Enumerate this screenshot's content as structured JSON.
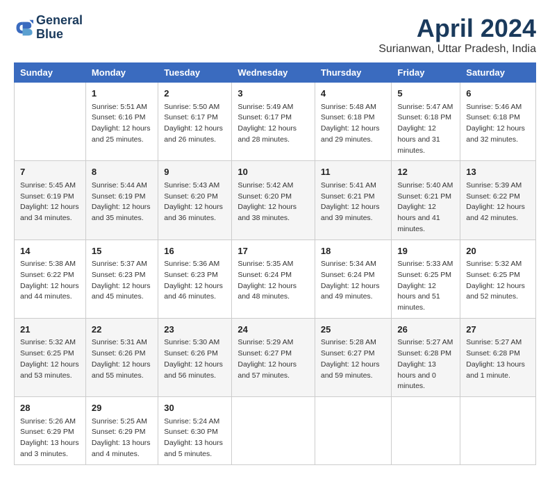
{
  "header": {
    "logo_line1": "General",
    "logo_line2": "Blue",
    "title": "April 2024",
    "subtitle": "Surianwan, Uttar Pradesh, India"
  },
  "days_of_week": [
    "Sunday",
    "Monday",
    "Tuesday",
    "Wednesday",
    "Thursday",
    "Friday",
    "Saturday"
  ],
  "weeks": [
    [
      {
        "day": "",
        "sunrise": "",
        "sunset": "",
        "daylight": ""
      },
      {
        "day": "1",
        "sunrise": "Sunrise: 5:51 AM",
        "sunset": "Sunset: 6:16 PM",
        "daylight": "Daylight: 12 hours and 25 minutes."
      },
      {
        "day": "2",
        "sunrise": "Sunrise: 5:50 AM",
        "sunset": "Sunset: 6:17 PM",
        "daylight": "Daylight: 12 hours and 26 minutes."
      },
      {
        "day": "3",
        "sunrise": "Sunrise: 5:49 AM",
        "sunset": "Sunset: 6:17 PM",
        "daylight": "Daylight: 12 hours and 28 minutes."
      },
      {
        "day": "4",
        "sunrise": "Sunrise: 5:48 AM",
        "sunset": "Sunset: 6:18 PM",
        "daylight": "Daylight: 12 hours and 29 minutes."
      },
      {
        "day": "5",
        "sunrise": "Sunrise: 5:47 AM",
        "sunset": "Sunset: 6:18 PM",
        "daylight": "Daylight: 12 hours and 31 minutes."
      },
      {
        "day": "6",
        "sunrise": "Sunrise: 5:46 AM",
        "sunset": "Sunset: 6:18 PM",
        "daylight": "Daylight: 12 hours and 32 minutes."
      }
    ],
    [
      {
        "day": "7",
        "sunrise": "Sunrise: 5:45 AM",
        "sunset": "Sunset: 6:19 PM",
        "daylight": "Daylight: 12 hours and 34 minutes."
      },
      {
        "day": "8",
        "sunrise": "Sunrise: 5:44 AM",
        "sunset": "Sunset: 6:19 PM",
        "daylight": "Daylight: 12 hours and 35 minutes."
      },
      {
        "day": "9",
        "sunrise": "Sunrise: 5:43 AM",
        "sunset": "Sunset: 6:20 PM",
        "daylight": "Daylight: 12 hours and 36 minutes."
      },
      {
        "day": "10",
        "sunrise": "Sunrise: 5:42 AM",
        "sunset": "Sunset: 6:20 PM",
        "daylight": "Daylight: 12 hours and 38 minutes."
      },
      {
        "day": "11",
        "sunrise": "Sunrise: 5:41 AM",
        "sunset": "Sunset: 6:21 PM",
        "daylight": "Daylight: 12 hours and 39 minutes."
      },
      {
        "day": "12",
        "sunrise": "Sunrise: 5:40 AM",
        "sunset": "Sunset: 6:21 PM",
        "daylight": "Daylight: 12 hours and 41 minutes."
      },
      {
        "day": "13",
        "sunrise": "Sunrise: 5:39 AM",
        "sunset": "Sunset: 6:22 PM",
        "daylight": "Daylight: 12 hours and 42 minutes."
      }
    ],
    [
      {
        "day": "14",
        "sunrise": "Sunrise: 5:38 AM",
        "sunset": "Sunset: 6:22 PM",
        "daylight": "Daylight: 12 hours and 44 minutes."
      },
      {
        "day": "15",
        "sunrise": "Sunrise: 5:37 AM",
        "sunset": "Sunset: 6:23 PM",
        "daylight": "Daylight: 12 hours and 45 minutes."
      },
      {
        "day": "16",
        "sunrise": "Sunrise: 5:36 AM",
        "sunset": "Sunset: 6:23 PM",
        "daylight": "Daylight: 12 hours and 46 minutes."
      },
      {
        "day": "17",
        "sunrise": "Sunrise: 5:35 AM",
        "sunset": "Sunset: 6:24 PM",
        "daylight": "Daylight: 12 hours and 48 minutes."
      },
      {
        "day": "18",
        "sunrise": "Sunrise: 5:34 AM",
        "sunset": "Sunset: 6:24 PM",
        "daylight": "Daylight: 12 hours and 49 minutes."
      },
      {
        "day": "19",
        "sunrise": "Sunrise: 5:33 AM",
        "sunset": "Sunset: 6:25 PM",
        "daylight": "Daylight: 12 hours and 51 minutes."
      },
      {
        "day": "20",
        "sunrise": "Sunrise: 5:32 AM",
        "sunset": "Sunset: 6:25 PM",
        "daylight": "Daylight: 12 hours and 52 minutes."
      }
    ],
    [
      {
        "day": "21",
        "sunrise": "Sunrise: 5:32 AM",
        "sunset": "Sunset: 6:25 PM",
        "daylight": "Daylight: 12 hours and 53 minutes."
      },
      {
        "day": "22",
        "sunrise": "Sunrise: 5:31 AM",
        "sunset": "Sunset: 6:26 PM",
        "daylight": "Daylight: 12 hours and 55 minutes."
      },
      {
        "day": "23",
        "sunrise": "Sunrise: 5:30 AM",
        "sunset": "Sunset: 6:26 PM",
        "daylight": "Daylight: 12 hours and 56 minutes."
      },
      {
        "day": "24",
        "sunrise": "Sunrise: 5:29 AM",
        "sunset": "Sunset: 6:27 PM",
        "daylight": "Daylight: 12 hours and 57 minutes."
      },
      {
        "day": "25",
        "sunrise": "Sunrise: 5:28 AM",
        "sunset": "Sunset: 6:27 PM",
        "daylight": "Daylight: 12 hours and 59 minutes."
      },
      {
        "day": "26",
        "sunrise": "Sunrise: 5:27 AM",
        "sunset": "Sunset: 6:28 PM",
        "daylight": "Daylight: 13 hours and 0 minutes."
      },
      {
        "day": "27",
        "sunrise": "Sunrise: 5:27 AM",
        "sunset": "Sunset: 6:28 PM",
        "daylight": "Daylight: 13 hours and 1 minute."
      }
    ],
    [
      {
        "day": "28",
        "sunrise": "Sunrise: 5:26 AM",
        "sunset": "Sunset: 6:29 PM",
        "daylight": "Daylight: 13 hours and 3 minutes."
      },
      {
        "day": "29",
        "sunrise": "Sunrise: 5:25 AM",
        "sunset": "Sunset: 6:29 PM",
        "daylight": "Daylight: 13 hours and 4 minutes."
      },
      {
        "day": "30",
        "sunrise": "Sunrise: 5:24 AM",
        "sunset": "Sunset: 6:30 PM",
        "daylight": "Daylight: 13 hours and 5 minutes."
      },
      {
        "day": "",
        "sunrise": "",
        "sunset": "",
        "daylight": ""
      },
      {
        "day": "",
        "sunrise": "",
        "sunset": "",
        "daylight": ""
      },
      {
        "day": "",
        "sunrise": "",
        "sunset": "",
        "daylight": ""
      },
      {
        "day": "",
        "sunrise": "",
        "sunset": "",
        "daylight": ""
      }
    ]
  ]
}
